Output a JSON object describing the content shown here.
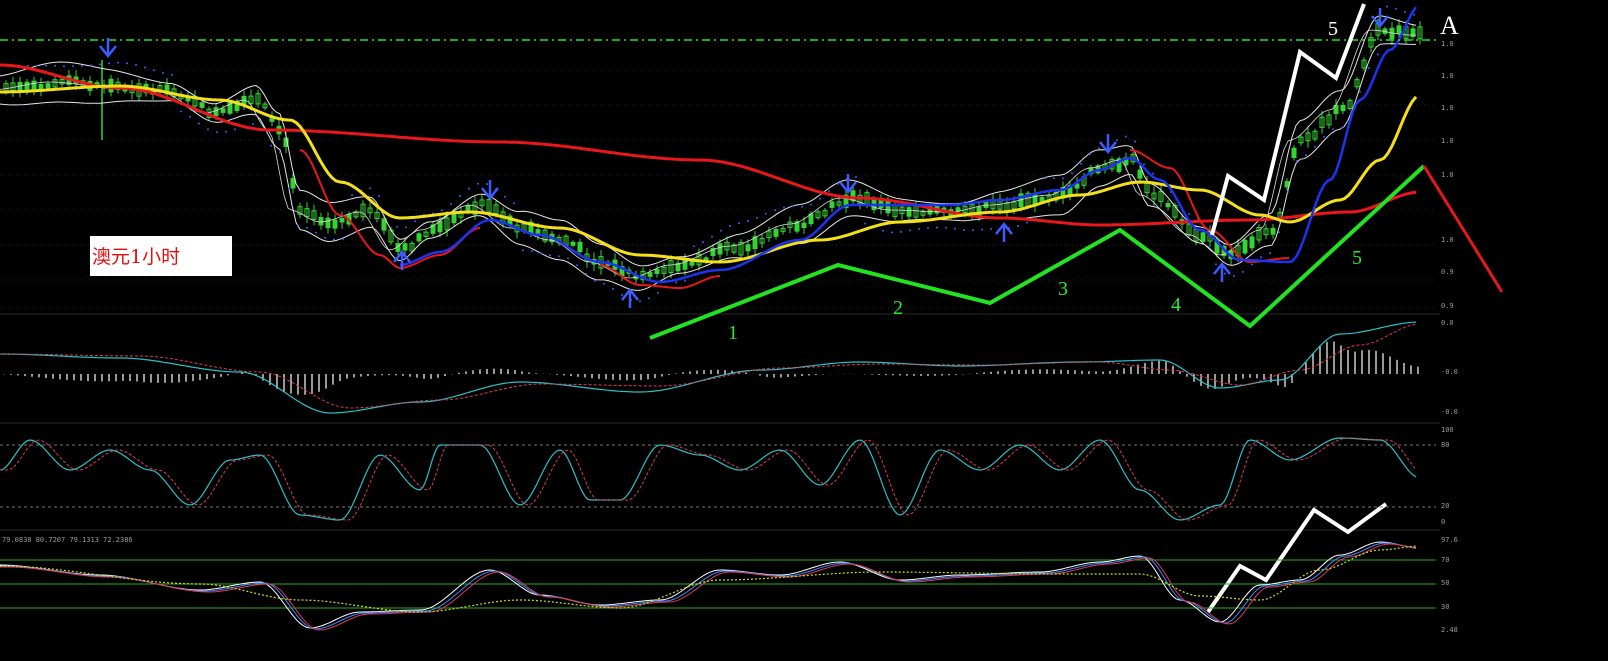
{
  "title": "澳元1小时",
  "corner_label": "A",
  "stoch_readout": "79.0838 80.7207 79.1313 72.2386",
  "colors": {
    "background": "#000000",
    "candle": "#34d434",
    "ma_red": "#e8171b",
    "ma_yellow": "#f4e01a",
    "ma_blue": "#1c33f2",
    "band_white": "#e6e6e6",
    "psar": "#3d5bff",
    "wave_green": "#22e222",
    "wave_white": "#ffffff",
    "hline": "#1fae1f",
    "macd_line": "#29c1c9",
    "signal_line": "#e03a5a"
  },
  "chart_data": [
    {
      "type": "line",
      "panel": "price",
      "title": "澳元1小时",
      "y_ticks": [
        "1.0",
        "1.0",
        "1.0",
        "1.0",
        "1.0",
        "1.0",
        "0.9",
        "0.9"
      ],
      "series": [
        {
          "style": "candlestick",
          "color": "#34d434"
        },
        {
          "style": "line",
          "color": "#e8171b"
        },
        {
          "style": "line",
          "color": "#f4e01a"
        },
        {
          "style": "line",
          "color": "#1c33f2"
        }
      ],
      "wave_labels": [
        "1",
        "2",
        "3",
        "4",
        "5",
        "5"
      ],
      "signals": {
        "down_arrows": 5,
        "up_arrows": 4
      },
      "horizontal_line": "dash-dot"
    },
    {
      "type": "line",
      "panel": "macd",
      "y_ticks": [
        "0.0",
        "-0.0",
        "-0.0"
      ]
    },
    {
      "type": "line",
      "panel": "kd",
      "y_ticks": [
        "100",
        "80",
        "20",
        "0"
      ],
      "levels": [
        80,
        20
      ]
    },
    {
      "type": "line",
      "panel": "stoch",
      "readout": "79.0838 80.7207 79.1313 72.2386",
      "y_ticks": [
        "97.6",
        "70",
        "50",
        "30",
        "2.48"
      ],
      "levels": [
        70,
        50,
        30
      ]
    }
  ]
}
